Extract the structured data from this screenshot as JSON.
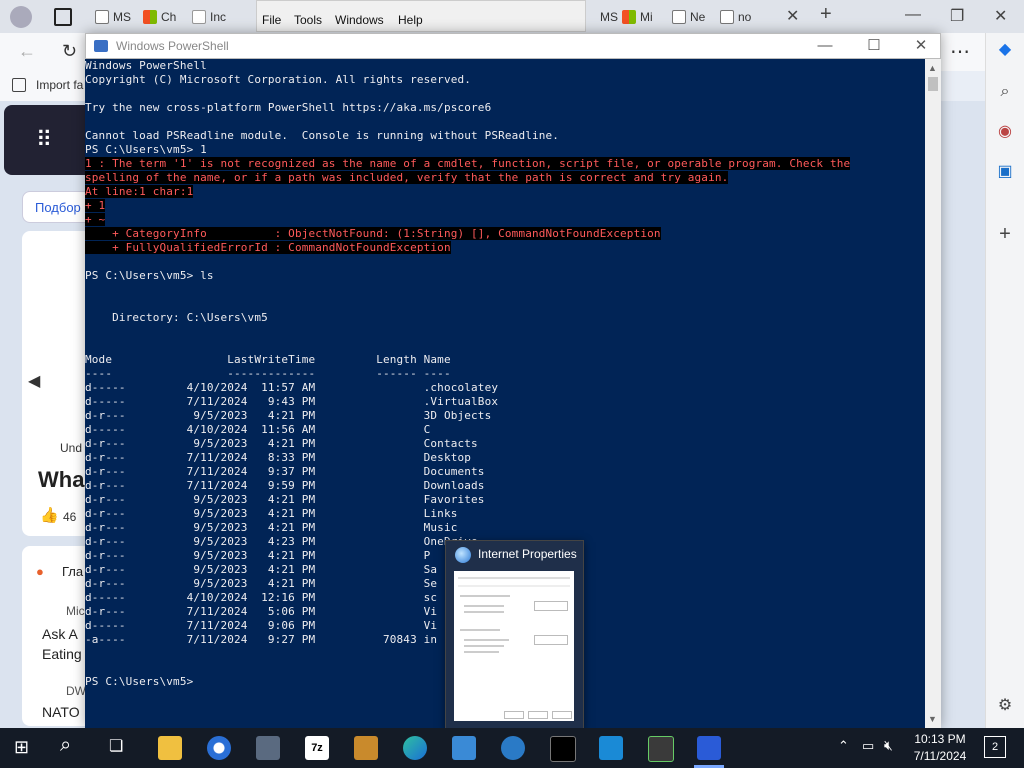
{
  "browser": {
    "tabs": [
      {
        "label": "MS"
      },
      {
        "label": "Ch"
      },
      {
        "label": "Inc"
      },
      {
        "label": "MS"
      },
      {
        "label": "Mi"
      },
      {
        "label": "Ne"
      },
      {
        "label": "no"
      }
    ],
    "favorites_label": "Import fa",
    "page": {
      "chip_label": "Подбор",
      "headline_fragment": "Wha",
      "source_fragment": "Und",
      "like_count": "46",
      "feed1": "Гла",
      "feed2_source": "Mic",
      "feed2_text1": "Ask A",
      "feed2_text2": "Eating",
      "feed3_source": "DW",
      "feed3_text": "NATO"
    }
  },
  "menu_strip": {
    "items": [
      "File",
      "Tools",
      "Windows",
      "Help"
    ]
  },
  "powershell": {
    "title": "Windows PowerShell",
    "banner": [
      "Windows PowerShell",
      "Copyright (C) Microsoft Corporation. All rights reserved.",
      "",
      "Try the new cross-platform PowerShell https://aka.ms/pscore6",
      "",
      "Cannot load PSReadline module.  Console is running without PSReadline.",
      "PS C:\\Users\\vm5> 1"
    ],
    "error_lines": [
      "1 : The term '1' is not recognized as the name of a cmdlet, function, script file, or operable program. Check the",
      "spelling of the name, or if a path was included, verify that the path is correct and try again.",
      "At line:1 char:1",
      "+ 1",
      "+ ~",
      "    + CategoryInfo          : ObjectNotFound: (1:String) [], CommandNotFoundException",
      "    + FullyQualifiedErrorId : CommandNotFoundException"
    ],
    "after_error": [
      " ",
      "PS C:\\Users\\vm5> ls",
      "",
      "",
      "    Directory: C:\\Users\\vm5",
      "",
      "",
      "Mode                 LastWriteTime         Length Name",
      "----                 -------------         ------ ----"
    ],
    "entries": [
      {
        "mode": "d-----",
        "date": "4/10/2024",
        "time": "11:57 AM",
        "length": "",
        "name": ".chocolatey"
      },
      {
        "mode": "d-----",
        "date": "7/11/2024",
        "time": "9:43 PM",
        "length": "",
        "name": ".VirtualBox"
      },
      {
        "mode": "d-r---",
        "date": "9/5/2023",
        "time": "4:21 PM",
        "length": "",
        "name": "3D Objects"
      },
      {
        "mode": "d-----",
        "date": "4/10/2024",
        "time": "11:56 AM",
        "length": "",
        "name": "C"
      },
      {
        "mode": "d-r---",
        "date": "9/5/2023",
        "time": "4:21 PM",
        "length": "",
        "name": "Contacts"
      },
      {
        "mode": "d-r---",
        "date": "7/11/2024",
        "time": "8:33 PM",
        "length": "",
        "name": "Desktop"
      },
      {
        "mode": "d-r---",
        "date": "7/11/2024",
        "time": "9:37 PM",
        "length": "",
        "name": "Documents"
      },
      {
        "mode": "d-r---",
        "date": "7/11/2024",
        "time": "9:59 PM",
        "length": "",
        "name": "Downloads"
      },
      {
        "mode": "d-r---",
        "date": "9/5/2023",
        "time": "4:21 PM",
        "length": "",
        "name": "Favorites"
      },
      {
        "mode": "d-r---",
        "date": "9/5/2023",
        "time": "4:21 PM",
        "length": "",
        "name": "Links"
      },
      {
        "mode": "d-r---",
        "date": "9/5/2023",
        "time": "4:21 PM",
        "length": "",
        "name": "Music"
      },
      {
        "mode": "d-r---",
        "date": "9/5/2023",
        "time": "4:23 PM",
        "length": "",
        "name": "OneDrive"
      },
      {
        "mode": "d-r---",
        "date": "9/5/2023",
        "time": "4:21 PM",
        "length": "",
        "name": "P"
      },
      {
        "mode": "d-r---",
        "date": "9/5/2023",
        "time": "4:21 PM",
        "length": "",
        "name": "Sa"
      },
      {
        "mode": "d-r---",
        "date": "9/5/2023",
        "time": "4:21 PM",
        "length": "",
        "name": "Se"
      },
      {
        "mode": "d-----",
        "date": "4/10/2024",
        "time": "12:16 PM",
        "length": "",
        "name": "sc"
      },
      {
        "mode": "d-r---",
        "date": "7/11/2024",
        "time": "5:06 PM",
        "length": "",
        "name": "Vi"
      },
      {
        "mode": "d-----",
        "date": "7/11/2024",
        "time": "9:06 PM",
        "length": "",
        "name": "Vi"
      },
      {
        "mode": "-a----",
        "date": "7/11/2024",
        "time": "9:27 PM",
        "length": "70843",
        "name": "in"
      }
    ],
    "footer": [
      "",
      "",
      "PS C:\\Users\\vm5>"
    ]
  },
  "internet_properties": {
    "title": "Internet Properties"
  },
  "taskbar": {
    "time": "10:13 PM",
    "date": "7/11/2024",
    "notification_count": "2",
    "app_7z_label": "7z"
  },
  "colors": {
    "ps_background": "#012456",
    "error_text": "#ff5a5a",
    "taskbar": "#141b26"
  }
}
